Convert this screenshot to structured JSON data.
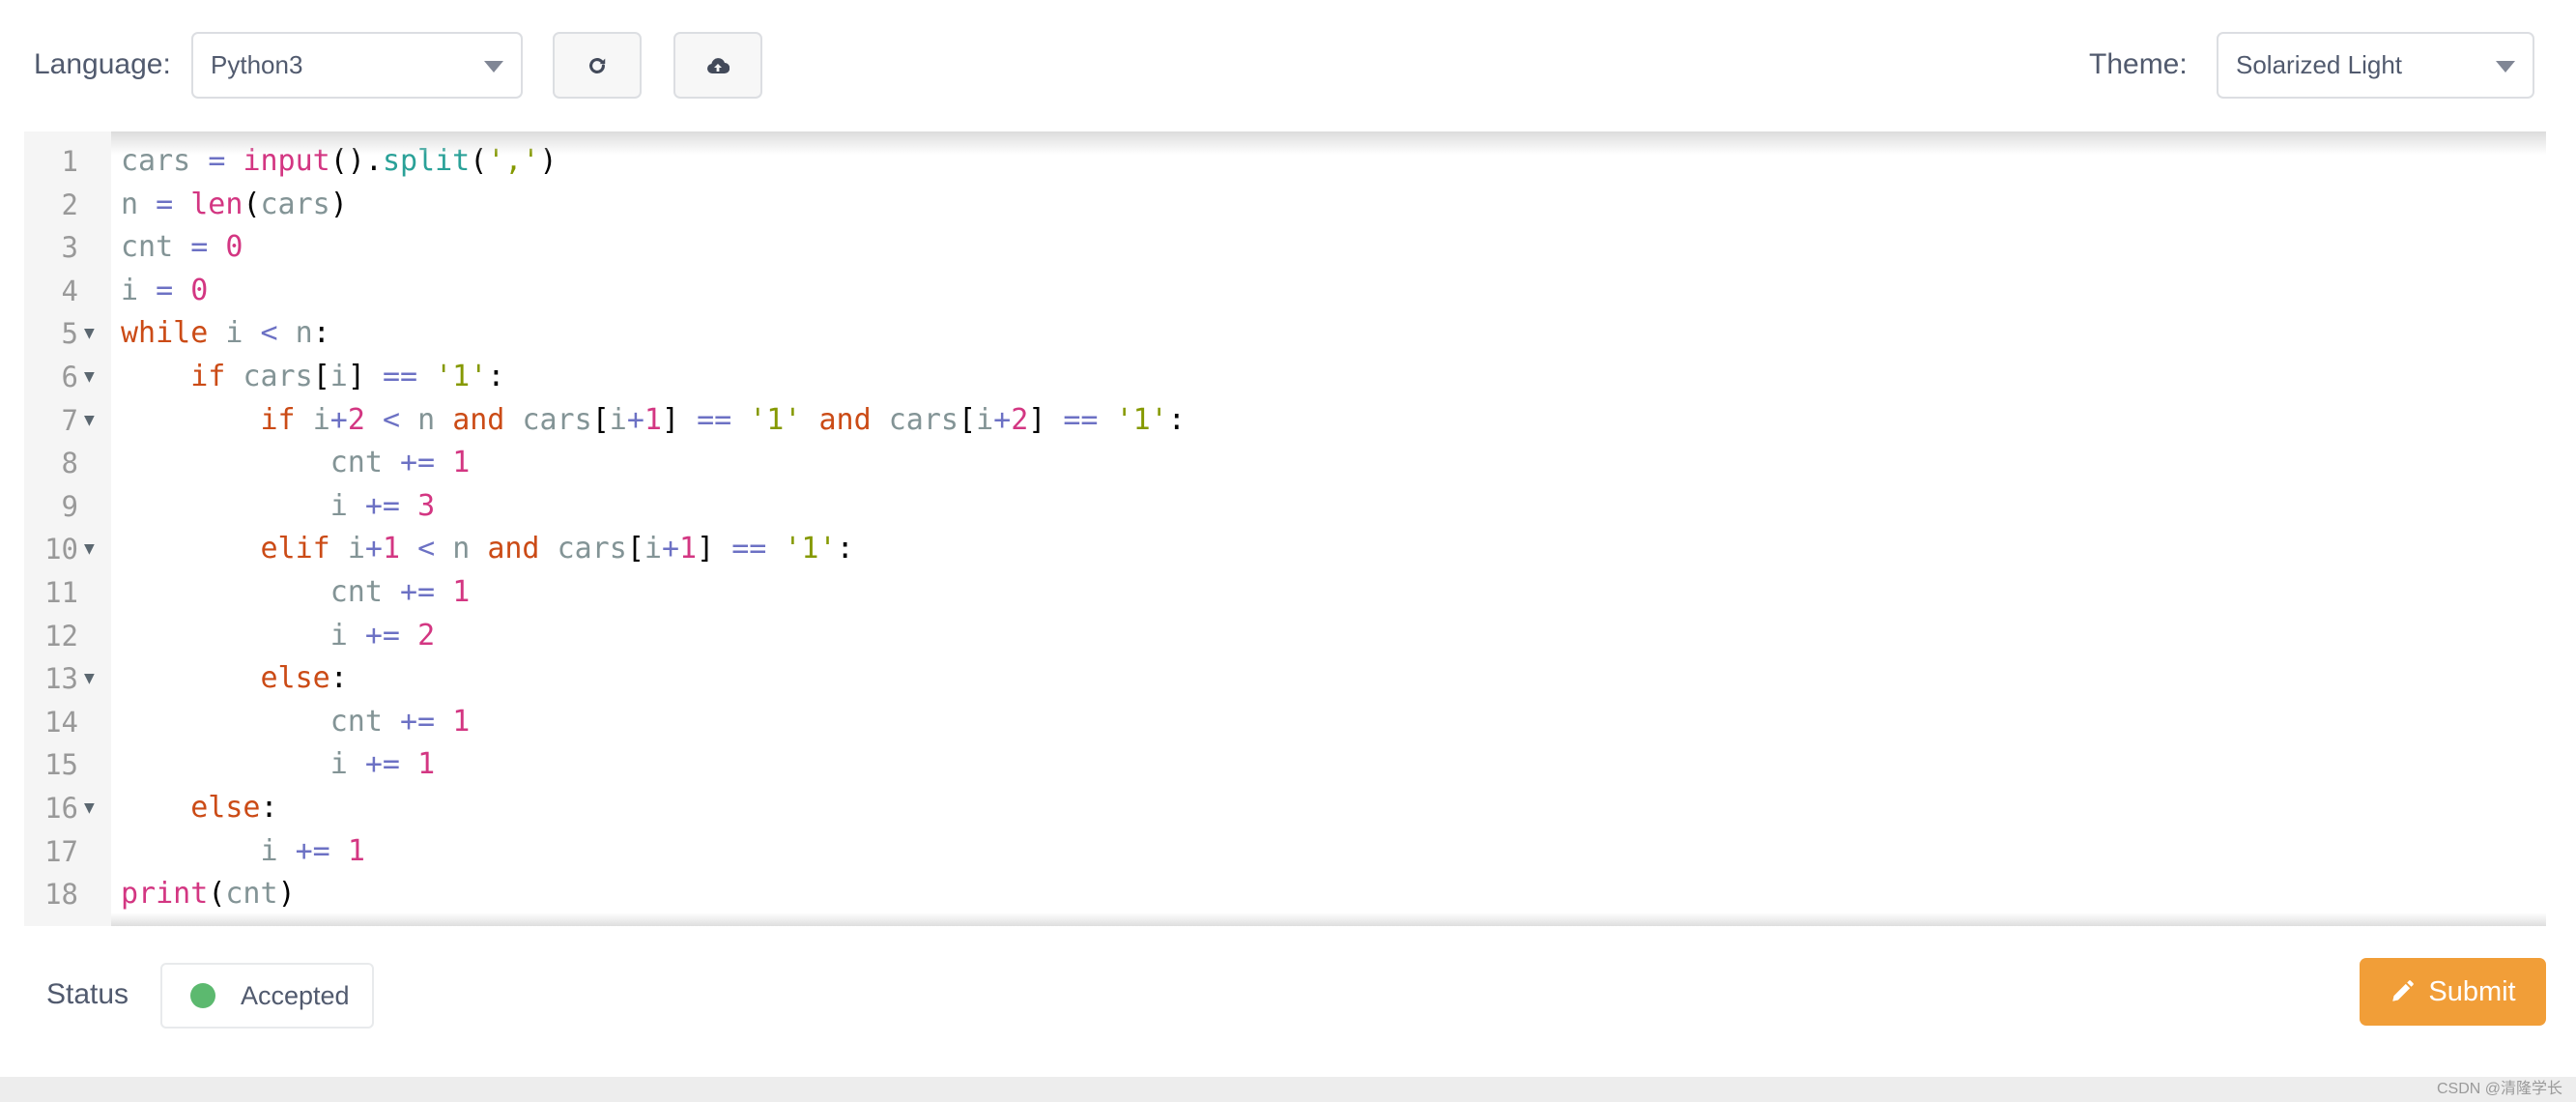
{
  "toolbar": {
    "language_label": "Language:",
    "language_value": "Python3",
    "reset_icon": "refresh-icon",
    "upload_icon": "cloud-upload-icon",
    "theme_label": "Theme:",
    "theme_value": "Solarized Light"
  },
  "editor": {
    "lines": [
      {
        "n": "1",
        "fold": false,
        "tokens": [
          [
            "var",
            "cars"
          ],
          [
            "",
            "' '"
          ],
          [
            "op",
            "="
          ],
          [
            "",
            ""
          ],
          [
            "builtin",
            "input"
          ],
          [
            "punc",
            "()."
          ],
          [
            "method",
            "split"
          ],
          [
            "punc",
            "("
          ],
          [
            "str",
            "','"
          ],
          [
            "punc",
            ")"
          ]
        ]
      },
      {
        "n": "2",
        "fold": false
      },
      {
        "n": "3",
        "fold": false
      },
      {
        "n": "4",
        "fold": false
      },
      {
        "n": "5",
        "fold": true
      },
      {
        "n": "6",
        "fold": true
      },
      {
        "n": "7",
        "fold": true
      },
      {
        "n": "8",
        "fold": false
      },
      {
        "n": "9",
        "fold": false
      },
      {
        "n": "10",
        "fold": true
      },
      {
        "n": "11",
        "fold": false
      },
      {
        "n": "12",
        "fold": false
      },
      {
        "n": "13",
        "fold": true
      },
      {
        "n": "14",
        "fold": false
      },
      {
        "n": "15",
        "fold": false
      },
      {
        "n": "16",
        "fold": true
      },
      {
        "n": "17",
        "fold": false
      },
      {
        "n": "18",
        "fold": false
      }
    ],
    "code": [
      [
        [
          "var",
          "cars"
        ],
        [
          "t",
          " "
        ],
        [
          "op",
          "="
        ],
        [
          "t",
          " "
        ],
        [
          "builtin",
          "input"
        ],
        [
          "punc",
          "()."
        ],
        [
          "method",
          "split"
        ],
        [
          "punc",
          "("
        ],
        [
          "str",
          "','"
        ],
        [
          "punc",
          ")"
        ]
      ],
      [
        [
          "var",
          "n"
        ],
        [
          "t",
          " "
        ],
        [
          "op",
          "="
        ],
        [
          "t",
          " "
        ],
        [
          "builtin",
          "len"
        ],
        [
          "punc",
          "("
        ],
        [
          "var",
          "cars"
        ],
        [
          "punc",
          ")"
        ]
      ],
      [
        [
          "var",
          "cnt"
        ],
        [
          "t",
          " "
        ],
        [
          "op",
          "="
        ],
        [
          "t",
          " "
        ],
        [
          "num",
          "0"
        ]
      ],
      [
        [
          "var",
          "i"
        ],
        [
          "t",
          " "
        ],
        [
          "op",
          "="
        ],
        [
          "t",
          " "
        ],
        [
          "num",
          "0"
        ]
      ],
      [
        [
          "kw",
          "while"
        ],
        [
          "t",
          " "
        ],
        [
          "var",
          "i"
        ],
        [
          "t",
          " "
        ],
        [
          "op",
          "<"
        ],
        [
          "t",
          " "
        ],
        [
          "var",
          "n"
        ],
        [
          "punc",
          ":"
        ]
      ],
      [
        [
          "t",
          "    "
        ],
        [
          "kw",
          "if"
        ],
        [
          "t",
          " "
        ],
        [
          "var",
          "cars"
        ],
        [
          "punc",
          "["
        ],
        [
          "var",
          "i"
        ],
        [
          "punc",
          "]"
        ],
        [
          "t",
          " "
        ],
        [
          "op",
          "=="
        ],
        [
          "t",
          " "
        ],
        [
          "str",
          "'1'"
        ],
        [
          "punc",
          ":"
        ]
      ],
      [
        [
          "t",
          "        "
        ],
        [
          "kw",
          "if"
        ],
        [
          "t",
          " "
        ],
        [
          "var",
          "i"
        ],
        [
          "op",
          "+"
        ],
        [
          "num",
          "2"
        ],
        [
          "t",
          " "
        ],
        [
          "op",
          "<"
        ],
        [
          "t",
          " "
        ],
        [
          "var",
          "n"
        ],
        [
          "t",
          " "
        ],
        [
          "kw",
          "and"
        ],
        [
          "t",
          " "
        ],
        [
          "var",
          "cars"
        ],
        [
          "punc",
          "["
        ],
        [
          "var",
          "i"
        ],
        [
          "op",
          "+"
        ],
        [
          "num",
          "1"
        ],
        [
          "punc",
          "]"
        ],
        [
          "t",
          " "
        ],
        [
          "op",
          "=="
        ],
        [
          "t",
          " "
        ],
        [
          "str",
          "'1'"
        ],
        [
          "t",
          " "
        ],
        [
          "kw",
          "and"
        ],
        [
          "t",
          " "
        ],
        [
          "var",
          "cars"
        ],
        [
          "punc",
          "["
        ],
        [
          "var",
          "i"
        ],
        [
          "op",
          "+"
        ],
        [
          "num",
          "2"
        ],
        [
          "punc",
          "]"
        ],
        [
          "t",
          " "
        ],
        [
          "op",
          "=="
        ],
        [
          "t",
          " "
        ],
        [
          "str",
          "'1'"
        ],
        [
          "punc",
          ":"
        ]
      ],
      [
        [
          "t",
          "            "
        ],
        [
          "var",
          "cnt"
        ],
        [
          "t",
          " "
        ],
        [
          "op",
          "+="
        ],
        [
          "t",
          " "
        ],
        [
          "num",
          "1"
        ]
      ],
      [
        [
          "t",
          "            "
        ],
        [
          "var",
          "i"
        ],
        [
          "t",
          " "
        ],
        [
          "op",
          "+="
        ],
        [
          "t",
          " "
        ],
        [
          "num",
          "3"
        ]
      ],
      [
        [
          "t",
          "        "
        ],
        [
          "kw",
          "elif"
        ],
        [
          "t",
          " "
        ],
        [
          "var",
          "i"
        ],
        [
          "op",
          "+"
        ],
        [
          "num",
          "1"
        ],
        [
          "t",
          " "
        ],
        [
          "op",
          "<"
        ],
        [
          "t",
          " "
        ],
        [
          "var",
          "n"
        ],
        [
          "t",
          " "
        ],
        [
          "kw",
          "and"
        ],
        [
          "t",
          " "
        ],
        [
          "var",
          "cars"
        ],
        [
          "punc",
          "["
        ],
        [
          "var",
          "i"
        ],
        [
          "op",
          "+"
        ],
        [
          "num",
          "1"
        ],
        [
          "punc",
          "]"
        ],
        [
          "t",
          " "
        ],
        [
          "op",
          "=="
        ],
        [
          "t",
          " "
        ],
        [
          "str",
          "'1'"
        ],
        [
          "punc",
          ":"
        ]
      ],
      [
        [
          "t",
          "            "
        ],
        [
          "var",
          "cnt"
        ],
        [
          "t",
          " "
        ],
        [
          "op",
          "+="
        ],
        [
          "t",
          " "
        ],
        [
          "num",
          "1"
        ]
      ],
      [
        [
          "t",
          "            "
        ],
        [
          "var",
          "i"
        ],
        [
          "t",
          " "
        ],
        [
          "op",
          "+="
        ],
        [
          "t",
          " "
        ],
        [
          "num",
          "2"
        ]
      ],
      [
        [
          "t",
          "        "
        ],
        [
          "kw",
          "else"
        ],
        [
          "punc",
          ":"
        ]
      ],
      [
        [
          "t",
          "            "
        ],
        [
          "var",
          "cnt"
        ],
        [
          "t",
          " "
        ],
        [
          "op",
          "+="
        ],
        [
          "t",
          " "
        ],
        [
          "num",
          "1"
        ]
      ],
      [
        [
          "t",
          "            "
        ],
        [
          "var",
          "i"
        ],
        [
          "t",
          " "
        ],
        [
          "op",
          "+="
        ],
        [
          "t",
          " "
        ],
        [
          "num",
          "1"
        ]
      ],
      [
        [
          "t",
          "    "
        ],
        [
          "kw",
          "else"
        ],
        [
          "punc",
          ":"
        ]
      ],
      [
        [
          "t",
          "        "
        ],
        [
          "var",
          "i"
        ],
        [
          "t",
          " "
        ],
        [
          "op",
          "+="
        ],
        [
          "t",
          " "
        ],
        [
          "num",
          "1"
        ]
      ],
      [
        [
          "builtin",
          "print"
        ],
        [
          "punc",
          "("
        ],
        [
          "var",
          "cnt"
        ],
        [
          "punc",
          ")"
        ]
      ]
    ]
  },
  "status": {
    "label": "Status",
    "value": "Accepted",
    "color": "#5cb96f"
  },
  "submit": {
    "label": "Submit",
    "icon": "pencil-icon",
    "color": "#f19e38"
  },
  "watermark": "CSDN @清隆学长"
}
